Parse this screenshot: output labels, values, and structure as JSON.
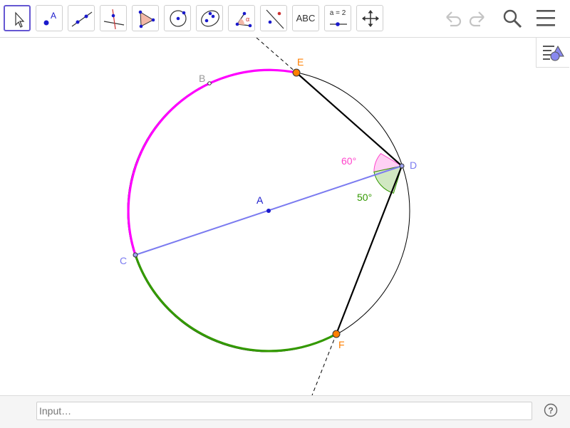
{
  "toolbar": {
    "tools": [
      {
        "id": "move",
        "icon": "move-arrow-icon",
        "active": true
      },
      {
        "id": "point",
        "icon": "point-icon",
        "letter": "A"
      },
      {
        "id": "line",
        "icon": "line-through-two-points-icon"
      },
      {
        "id": "perpendicular",
        "icon": "perpendicular-line-icon"
      },
      {
        "id": "polygon",
        "icon": "polygon-icon"
      },
      {
        "id": "circle-center",
        "icon": "circle-with-center-icon"
      },
      {
        "id": "ellipse",
        "icon": "ellipse-icon"
      },
      {
        "id": "angle",
        "icon": "angle-icon",
        "letter": "α"
      },
      {
        "id": "reflect",
        "icon": "reflect-about-line-icon"
      },
      {
        "id": "text",
        "icon": "text-icon",
        "label": "ABC"
      },
      {
        "id": "slider",
        "icon": "slider-icon",
        "label": "a = 2"
      },
      {
        "id": "move-graphics",
        "icon": "move-graphics-view-icon"
      }
    ],
    "undo_icon": "undo-icon",
    "redo_icon": "redo-icon",
    "search_icon": "search-icon",
    "menu_icon": "hamburger-menu-icon"
  },
  "style_bar_icon": "style-bar-toggle-icon",
  "construction": {
    "points": {
      "A": {
        "label": "A",
        "color": "#1a1acc"
      },
      "B": {
        "label": "B",
        "color": "#999999"
      },
      "C": {
        "label": "C",
        "color": "#7b7bf0"
      },
      "D": {
        "label": "D",
        "color": "#7b7bf0"
      },
      "E": {
        "label": "E",
        "color": "#ff7f00"
      },
      "F": {
        "label": "F",
        "color": "#ff7f00"
      }
    },
    "angles": [
      {
        "label": "60°",
        "color": "#ff44cc"
      },
      {
        "label": "50°",
        "color": "#339900"
      }
    ],
    "colors": {
      "arc_magenta": "#ff00ff",
      "arc_green": "#339900",
      "diameter": "#7b7bf0",
      "circle": "#000000",
      "chords": "#000000"
    }
  },
  "input_bar": {
    "placeholder": "Input…",
    "help_icon": "help-icon"
  }
}
